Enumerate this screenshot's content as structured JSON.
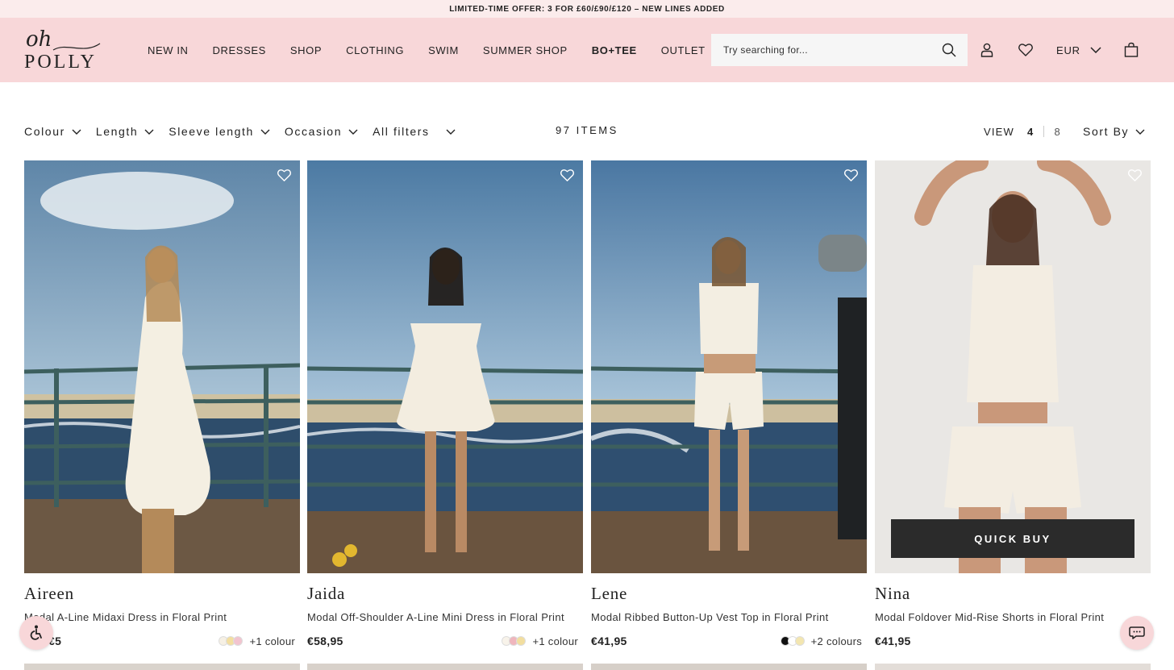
{
  "promo": {
    "text": "LIMITED-TIME OFFER: 3 FOR £60/£90/£120 – NEW LINES ADDED"
  },
  "header": {
    "logo": {
      "top": "oh",
      "bottom": "POLLY"
    },
    "nav": [
      "NEW IN",
      "DRESSES",
      "SHOP",
      "CLOTHING",
      "SWIM",
      "SUMMER SHOP",
      "BO+TEE",
      "OUTLET"
    ],
    "search_placeholder": "Try searching for...",
    "currency": "EUR",
    "icons": [
      "search-icon",
      "account-icon",
      "wishlist-icon",
      "chevron-down-icon",
      "bag-icon"
    ]
  },
  "filters": {
    "items": [
      "Colour",
      "Length",
      "Sleeve length",
      "Occasion",
      "All filters"
    ],
    "count": "97 ITEMS",
    "view_label": "VIEW",
    "view_options": [
      "4",
      "8"
    ],
    "view_active": "4",
    "sort_label": "Sort By"
  },
  "products": [
    {
      "name": "Aireen",
      "description": "Modal A-Line Midaxi Dress in Floral Print",
      "price": "€5",
      "swatches": [
        "#f6f0e4",
        "#f3dea0",
        "#f2c4cf"
      ],
      "more_colours": "+1 colour"
    },
    {
      "name": "Jaida",
      "description": "Modal Off-Shoulder A-Line Mini Dress in Floral Print",
      "price": "€58,95",
      "swatches": [
        "#f8f3ea",
        "#efb6bd",
        "#f2de9f"
      ],
      "more_colours": "+1 colour"
    },
    {
      "name": "Lene",
      "description": "Modal Ribbed Button-Up Vest Top in Floral Print",
      "price": "€41,95",
      "swatches": [
        "#111111",
        "#ffffff",
        "#f3e6b0"
      ],
      "more_colours": "+2 colours"
    },
    {
      "name": "Nina",
      "description": "Modal Foldover Mid-Rise Shorts in Floral Print",
      "price": "€41,95",
      "swatches": [],
      "more_colours": "",
      "quick_buy": "QUICK BUY"
    }
  ],
  "colors": {
    "header_bg": "#f8d7d9",
    "promo_bg": "#fbecec",
    "quick_buy_bg": "#2b2b2b"
  }
}
